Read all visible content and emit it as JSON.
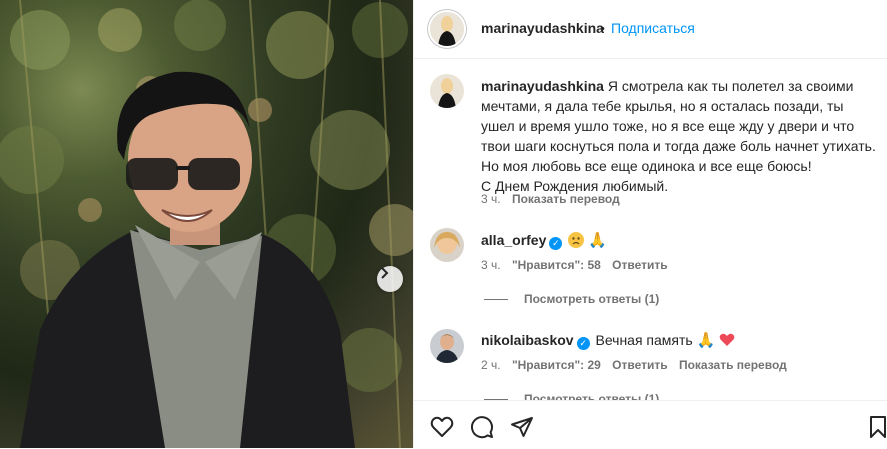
{
  "post": {
    "author": "marinayudashkina",
    "separator": "•",
    "follow_label": "Подписаться",
    "caption_lines": [
      "Я смотрела как ты полетел за своими мечтами, я дала тебе крылья, но я осталась позади, ты ушел и время ушло тоже, но я все еще жду у двери и что твои шаги коснуться пола и тогда даже боль начнет утихать. Но моя любовь все еще одинока и все еще боюсь!",
      "С Днем Рождения любимый."
    ],
    "caption_time": "3 ч.",
    "caption_translate": "Показать перевод"
  },
  "comments": [
    {
      "username": "alla_orfey",
      "text": "",
      "emoji": [
        "sad-face",
        "praying-hands"
      ],
      "time": "3 ч.",
      "likes_label": "\"Нравится\": 58",
      "reply_label": "Ответить",
      "translate_label": "",
      "view_replies": "Посмотреть ответы (1)"
    },
    {
      "username": "nikolaibaskov",
      "text": "Вечная память",
      "emoji": [
        "praying-hands",
        "red-heart"
      ],
      "time": "2 ч.",
      "likes_label": "\"Нравится\": 29",
      "reply_label": "Ответить",
      "translate_label": "Показать перевод",
      "view_replies": "Посмотреть ответы (1)"
    }
  ],
  "colors": {
    "accent": "#0095f6",
    "muted": "#737373",
    "text": "#262626",
    "heart": "#ed4956"
  },
  "icons": [
    "heart-icon",
    "comment-icon",
    "share-icon",
    "bookmark-icon",
    "chevron-right-icon",
    "verified-badge-icon"
  ]
}
